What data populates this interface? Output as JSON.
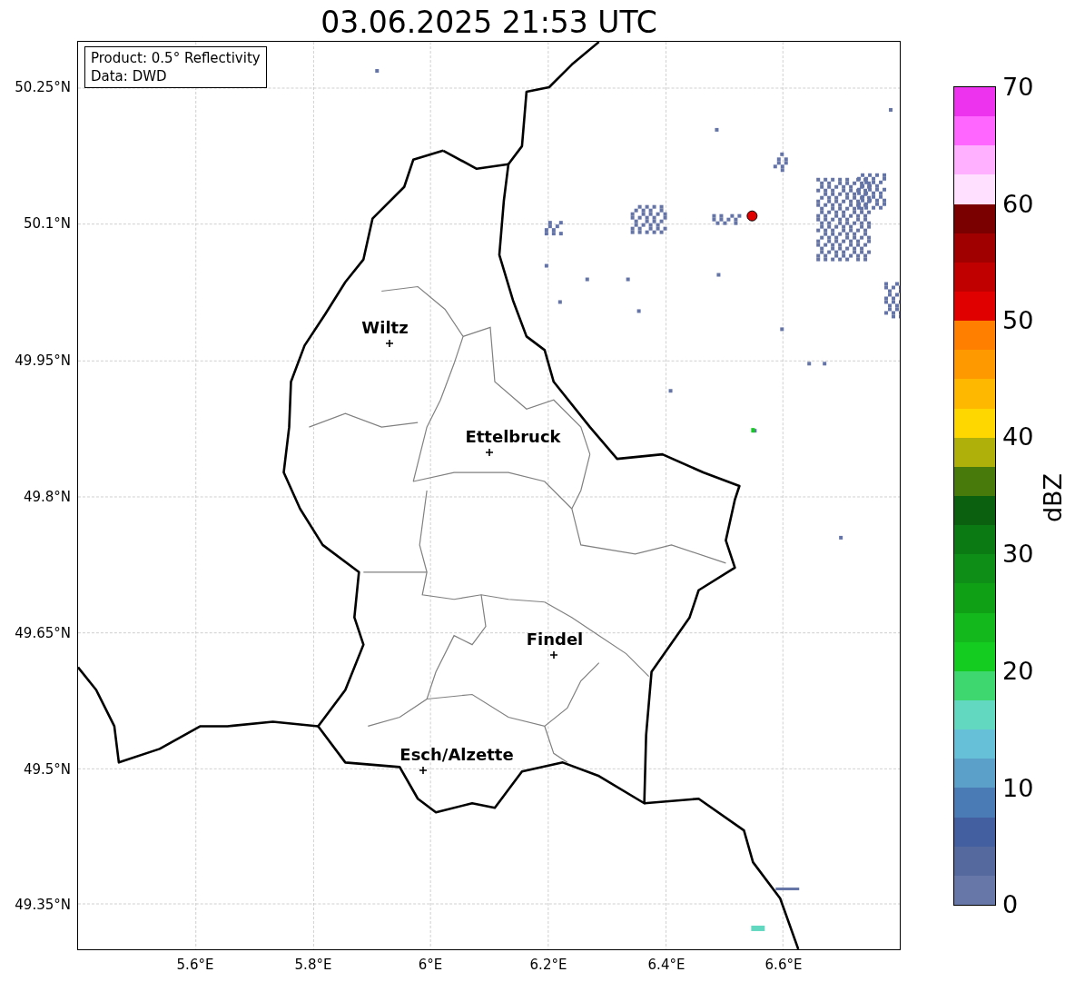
{
  "title": "03.06.2025 21:53 UTC",
  "info_box": {
    "lines": [
      "Product: 0.5° Reflectivity",
      "Data: DWD"
    ]
  },
  "map": {
    "lat_ticks": [
      "50.25°N",
      "50.1°N",
      "49.95°N",
      "49.8°N",
      "49.65°N",
      "49.5°N",
      "49.35°N"
    ],
    "lon_ticks": [
      "5.6°E",
      "5.8°E",
      "6°E",
      "6.2°E",
      "6.4°E",
      "6.6°E"
    ],
    "cities": [
      {
        "name": "Wiltz"
      },
      {
        "name": "Ettelbruck"
      },
      {
        "name": "Findel"
      },
      {
        "name": "Esch/Alzette"
      }
    ]
  },
  "colorbar": {
    "label": "dBZ",
    "ticks": [
      "70",
      "60",
      "50",
      "40",
      "30",
      "20",
      "10",
      "0"
    ],
    "segments": [
      {
        "color": "#ee33ee"
      },
      {
        "color": "#ff66ff"
      },
      {
        "color": "#ffb0ff"
      },
      {
        "color": "#ffe0ff"
      },
      {
        "color": "#7a0000"
      },
      {
        "color": "#a00000"
      },
      {
        "color": "#c00000"
      },
      {
        "color": "#e00000"
      },
      {
        "color": "#ff7f00"
      },
      {
        "color": "#ff9900"
      },
      {
        "color": "#ffb800"
      },
      {
        "color": "#ffd700"
      },
      {
        "color": "#b0b00a"
      },
      {
        "color": "#477a0a"
      },
      {
        "color": "#0a600e"
      },
      {
        "color": "#0c7a12"
      },
      {
        "color": "#0e8e16"
      },
      {
        "color": "#10a016"
      },
      {
        "color": "#12b81c"
      },
      {
        "color": "#14cc20"
      },
      {
        "color": "#3ed66e"
      },
      {
        "color": "#62d8c0"
      },
      {
        "color": "#66c0d8"
      },
      {
        "color": "#5ba0c8"
      },
      {
        "color": "#4a7bb5"
      },
      {
        "color": "#445fa0"
      },
      {
        "color": "#56699e"
      },
      {
        "color": "#6677a8"
      }
    ]
  }
}
